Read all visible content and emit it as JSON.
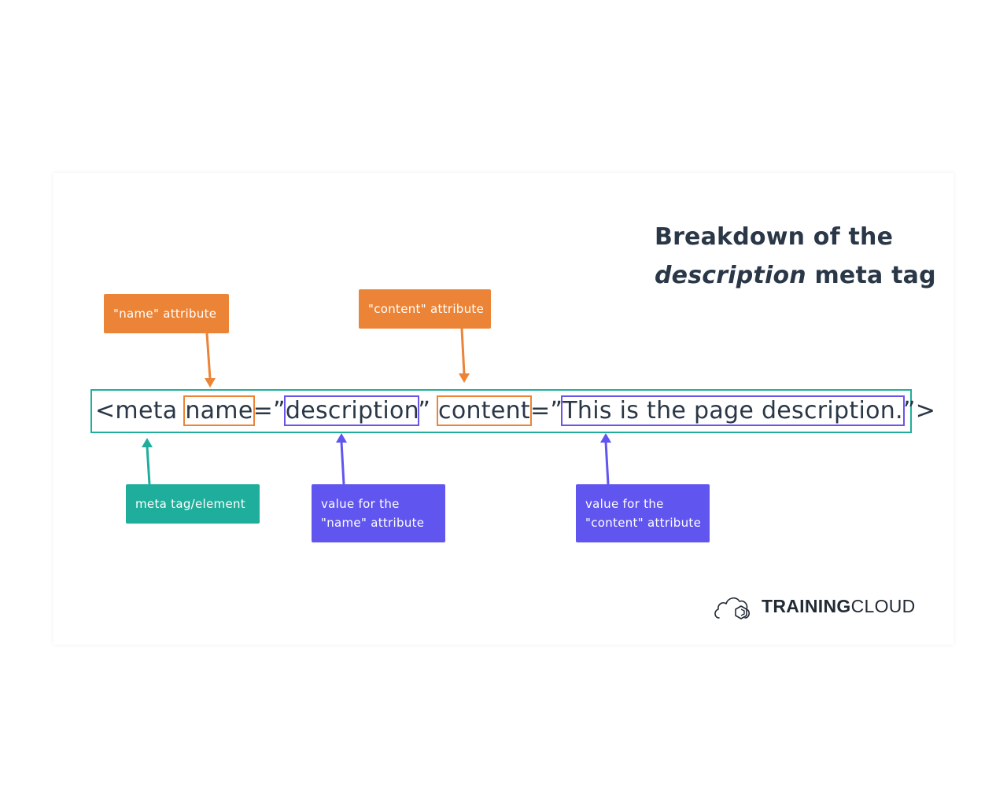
{
  "title": {
    "line1": "Breakdown of the",
    "line2_italic": "description",
    "line2_rest": " meta tag"
  },
  "code": {
    "prefix": "<meta ",
    "attr_name": "name",
    "eq1": "=”",
    "value_name": "description",
    "close1": "” ",
    "attr_content": "content",
    "eq2": "=”",
    "value_content": "This is the page description.",
    "close2": "”>"
  },
  "labels": {
    "name_attribute": "\"name\" attribute",
    "content_attribute": "\"content\" attribute",
    "meta_tag": "meta tag/element",
    "value_name_line1": "value for the",
    "value_name_line2": "\"name\" attribute",
    "value_content_line1": "value for the",
    "value_content_line2": "\"content\" attribute"
  },
  "brand": {
    "bold": "TRAINING",
    "regular": "CLOUD",
    "icon": "cloud-logo-icon"
  },
  "colors": {
    "orange": "#ec8437",
    "teal": "#1fae9b",
    "purple": "#6155ef",
    "text": "#2a3747"
  }
}
